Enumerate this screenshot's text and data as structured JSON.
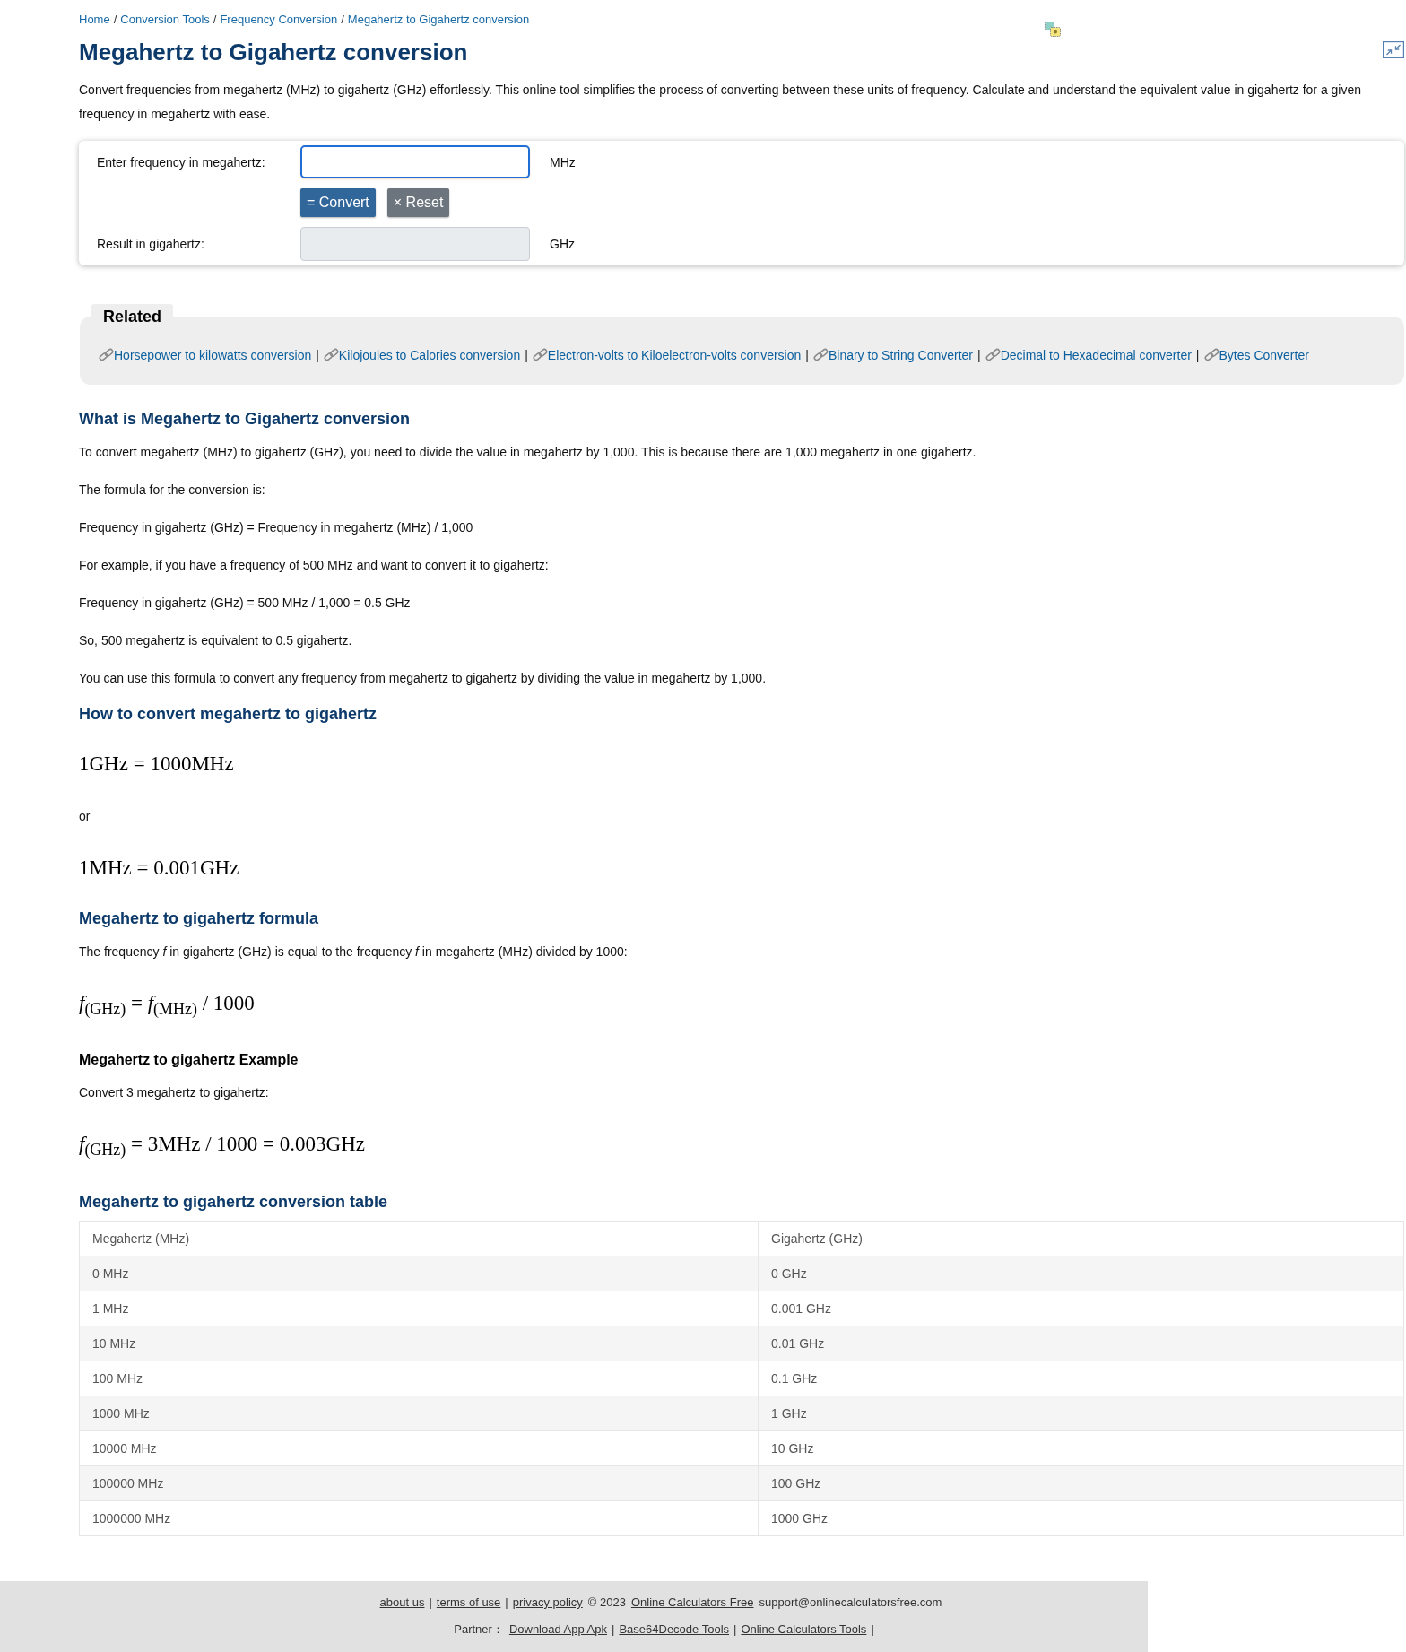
{
  "breadcrumb": [
    {
      "label": "Home",
      "separator": "/"
    },
    {
      "label": "Conversion Tools",
      "separator": "/"
    },
    {
      "label": "Frequency Conversion",
      "separator": "/"
    },
    {
      "label": "Megahertz to Gigahertz conversion"
    }
  ],
  "title": "Megahertz to Gigahertz conversion",
  "description": "Convert frequencies from megahertz (MHz) to gigahertz (GHz) effortlessly. This online tool simplifies the process of converting between these units of frequency. Calculate and understand the equivalent value in gigahertz for a given frequency in megahertz with ease.",
  "converter": {
    "fields": [
      {
        "kind": "input",
        "label": "Enter frequency in megahertz:",
        "unit": "MHz",
        "focused": true,
        "readonly": false
      },
      {
        "kind": "result",
        "label": "Result in gigahertz:",
        "unit": "GHz",
        "focused": false,
        "readonly": true
      }
    ],
    "buttons": [
      {
        "kind": "primary",
        "label": "= Convert"
      },
      {
        "kind": "secondary",
        "label": "× Reset"
      }
    ]
  },
  "related": {
    "title": "Related",
    "links": [
      {
        "label": "Horsepower to kilowatts conversion",
        "separator": "|"
      },
      {
        "label": "Kilojoules to Calories conversion",
        "separator": "|"
      },
      {
        "label": "Electron-volts to Kiloelectron-volts conversion",
        "separator": "|"
      },
      {
        "label": "Binary to String Converter",
        "separator": "|"
      },
      {
        "label": "Decimal to Hexadecimal converter",
        "separator": "|"
      },
      {
        "label": "Bytes Converter"
      }
    ]
  },
  "sections": [
    {
      "kind": "heading",
      "text": "What is Megahertz to Gigahertz conversion"
    },
    {
      "kind": "paragraph",
      "text": "To convert megahertz (MHz) to gigahertz (GHz), you need to divide the value in megahertz by 1,000. This is because there are 1,000 megahertz in one gigahertz."
    },
    {
      "kind": "paragraph",
      "text": "The formula for the conversion is:"
    },
    {
      "kind": "paragraph",
      "text": "Frequency in gigahertz (GHz) = Frequency in megahertz (MHz) / 1,000"
    },
    {
      "kind": "paragraph",
      "text": "For example, if you have a frequency of 500 MHz and want to convert it to gigahertz:"
    },
    {
      "kind": "paragraph",
      "text": "Frequency in gigahertz (GHz) = 500 MHz / 1,000 = 0.5 GHz"
    },
    {
      "kind": "paragraph",
      "text": "So, 500 megahertz is equivalent to 0.5 gigahertz."
    },
    {
      "kind": "paragraph",
      "text": "You can use this formula to convert any frequency from megahertz to gigahertz by dividing the value in megahertz by 1,000."
    },
    {
      "kind": "heading",
      "text": "How to convert megahertz to gigahertz"
    },
    {
      "kind": "math",
      "text": "1GHz = 1000MHz"
    },
    {
      "kind": "paragraph",
      "text": "or"
    },
    {
      "kind": "math",
      "text": "1MHz = 0.001GHz"
    },
    {
      "kind": "heading",
      "text": "Megahertz to gigahertz formula"
    },
    {
      "kind": "paragraph",
      "text": "The frequency *f* in gigahertz (GHz) is equal to the frequency *f* in megahertz (MHz) divided by 1000:"
    },
    {
      "kind": "math",
      "text": "*f*$_{(GHz)}$ = *f*$_{(MHz)}$ / 1000"
    },
    {
      "kind": "subheading",
      "text": "Megahertz to gigahertz Example"
    },
    {
      "kind": "paragraph",
      "text": "Convert 3 megahertz to gigahertz:"
    },
    {
      "kind": "math",
      "text": "*f*$_{(GHz)}$ = 3MHz / 1000 = 0.003GHz"
    },
    {
      "kind": "heading",
      "text": "Megahertz to gigahertz conversion table"
    }
  ],
  "table": {
    "columns": [
      "Megahertz (MHz)",
      "Gigahertz (GHz)"
    ],
    "rows": [
      [
        "0 MHz",
        "0 GHz"
      ],
      [
        "1 MHz",
        "0.001 GHz"
      ],
      [
        "10 MHz",
        "0.01 GHz"
      ],
      [
        "100 MHz",
        "0.1 GHz"
      ],
      [
        "1000 MHz",
        "1 GHz"
      ],
      [
        "10000 MHz",
        "10 GHz"
      ],
      [
        "100000 MHz",
        "100 GHz"
      ],
      [
        "1000000 MHz",
        "1000 GHz"
      ]
    ]
  },
  "footer": {
    "lines": [
      [
        {
          "kind": "link",
          "text": "about us",
          "separator": "|"
        },
        {
          "kind": "link",
          "text": "terms of use",
          "separator": "|"
        },
        {
          "kind": "link",
          "text": "privacy policy"
        },
        {
          "kind": "text",
          "text": "© 2023"
        },
        {
          "kind": "link",
          "text": "Online Calculators Free"
        },
        {
          "kind": "text",
          "text": "support@onlinecalculatorsfree.com"
        }
      ],
      [
        {
          "kind": "text",
          "text": "Partner："
        },
        {
          "kind": "link",
          "text": "Download App Apk",
          "separator": "|"
        },
        {
          "kind": "link",
          "text": "Base64Decode Tools",
          "separator": "|"
        },
        {
          "kind": "link",
          "text": "Online Calculators Tools",
          "separator": "|"
        }
      ]
    ]
  }
}
